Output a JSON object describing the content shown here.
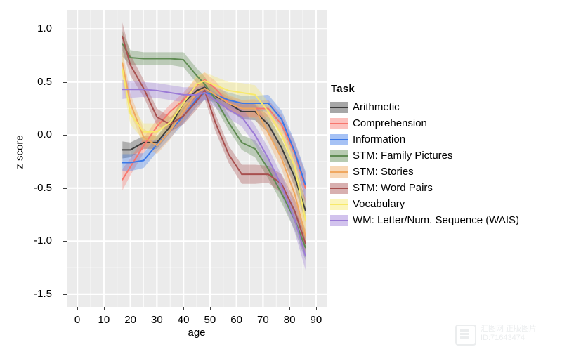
{
  "chart_data": {
    "type": "line",
    "title": "",
    "xlabel": "age",
    "ylabel": "z score",
    "xlim": [
      -4,
      94
    ],
    "ylim": [
      -1.62,
      1.18
    ],
    "xticks": [
      0,
      10,
      20,
      30,
      40,
      50,
      60,
      70,
      80,
      90
    ],
    "xtick_labels": [
      "0",
      "10",
      "20",
      "30",
      "40",
      "50",
      "60",
      "70",
      "80",
      "90"
    ],
    "yticks": [
      1.0,
      0.5,
      0.0,
      -0.5,
      -1.0,
      -1.5
    ],
    "ytick_labels": [
      "1.0",
      "0.5",
      "0.0",
      "-0.5",
      "-1.0",
      "-1.5"
    ],
    "grid": true,
    "grid_minor": true,
    "panel_bg": "#ebebeb",
    "grid_color": "#ffffff",
    "legend_title": "Task",
    "legend_position": "right",
    "band_type": "confidence ribbon",
    "series": [
      {
        "name": "Arithmetic",
        "color": "#3c3c3c",
        "x": [
          17,
          20,
          25,
          30,
          35,
          40,
          45,
          48,
          52,
          57,
          62,
          67,
          72,
          77,
          82,
          86
        ],
        "y": [
          -0.14,
          -0.14,
          -0.07,
          -0.07,
          0.08,
          0.3,
          0.42,
          0.45,
          0.37,
          0.3,
          0.22,
          0.22,
          0.1,
          -0.12,
          -0.4,
          -0.71
        ],
        "lower": [
          -0.22,
          -0.21,
          -0.13,
          -0.13,
          0.02,
          0.24,
          0.36,
          0.39,
          0.31,
          0.24,
          0.15,
          0.14,
          0.02,
          -0.2,
          -0.49,
          -0.82
        ],
        "upper": [
          -0.06,
          -0.07,
          -0.01,
          -0.01,
          0.14,
          0.36,
          0.48,
          0.51,
          0.43,
          0.36,
          0.29,
          0.3,
          0.18,
          -0.04,
          -0.31,
          -0.6
        ]
      },
      {
        "name": "Comprehension",
        "color": "#f8766d",
        "x": [
          17,
          20,
          25,
          30,
          35,
          40,
          45,
          48,
          52,
          57,
          62,
          67,
          72,
          77,
          82,
          86
        ],
        "y": [
          -0.42,
          -0.3,
          -0.1,
          0.08,
          0.22,
          0.33,
          0.47,
          0.52,
          0.44,
          0.3,
          0.25,
          0.25,
          0.25,
          0.1,
          -0.18,
          -0.5
        ],
        "lower": [
          -0.52,
          -0.38,
          -0.17,
          0.01,
          0.15,
          0.26,
          0.4,
          0.45,
          0.37,
          0.23,
          0.17,
          0.17,
          0.17,
          0.01,
          -0.29,
          -0.64
        ],
        "upper": [
          -0.32,
          -0.22,
          -0.03,
          0.15,
          0.29,
          0.4,
          0.54,
          0.59,
          0.51,
          0.37,
          0.33,
          0.33,
          0.33,
          0.19,
          -0.07,
          -0.36
        ]
      },
      {
        "name": "Information",
        "color": "#3a78e8",
        "x": [
          17,
          20,
          25,
          30,
          35,
          40,
          45,
          48,
          52,
          57,
          62,
          67,
          72,
          77,
          82,
          86
        ],
        "y": [
          -0.26,
          -0.26,
          -0.24,
          -0.09,
          0.04,
          0.18,
          0.34,
          0.4,
          0.38,
          0.33,
          0.3,
          0.3,
          0.3,
          0.15,
          -0.16,
          -0.47
        ],
        "lower": [
          -0.34,
          -0.34,
          -0.31,
          -0.16,
          -0.03,
          0.11,
          0.27,
          0.33,
          0.31,
          0.26,
          0.23,
          0.23,
          0.22,
          0.07,
          -0.26,
          -0.6
        ],
        "upper": [
          -0.18,
          -0.18,
          -0.17,
          -0.02,
          0.11,
          0.25,
          0.41,
          0.47,
          0.45,
          0.4,
          0.37,
          0.37,
          0.38,
          0.23,
          -0.06,
          -0.34
        ]
      },
      {
        "name": "STM: Family Pictures",
        "color": "#5f8b52",
        "x": [
          17,
          20,
          25,
          30,
          35,
          40,
          45,
          48,
          52,
          57,
          62,
          67,
          72,
          77,
          82,
          86
        ],
        "y": [
          0.86,
          0.73,
          0.72,
          0.72,
          0.72,
          0.71,
          0.56,
          0.48,
          0.34,
          0.12,
          -0.07,
          -0.13,
          -0.32,
          -0.55,
          -0.8,
          -1.06
        ],
        "lower": [
          0.74,
          0.66,
          0.66,
          0.66,
          0.66,
          0.64,
          0.49,
          0.41,
          0.27,
          0.05,
          -0.14,
          -0.21,
          -0.41,
          -0.64,
          -0.9,
          -1.18
        ],
        "upper": [
          0.98,
          0.8,
          0.78,
          0.78,
          0.78,
          0.78,
          0.63,
          0.55,
          0.41,
          0.19,
          0.0,
          -0.05,
          -0.23,
          -0.46,
          -0.7,
          -0.94
        ]
      },
      {
        "name": "STM: Stories",
        "color": "#f0a860",
        "x": [
          17,
          20,
          25,
          30,
          35,
          40,
          45,
          48,
          52,
          57,
          62,
          67,
          72,
          77,
          82,
          86
        ],
        "y": [
          0.68,
          0.3,
          -0.02,
          -0.1,
          0.04,
          0.22,
          0.4,
          0.44,
          0.38,
          0.3,
          0.25,
          0.25,
          0.02,
          -0.22,
          -0.56,
          -0.95
        ],
        "lower": [
          0.56,
          0.21,
          -0.1,
          -0.18,
          -0.04,
          0.14,
          0.33,
          0.37,
          0.31,
          0.22,
          0.17,
          0.16,
          -0.07,
          -0.32,
          -0.68,
          -1.08
        ],
        "upper": [
          0.8,
          0.39,
          0.06,
          -0.02,
          0.12,
          0.3,
          0.47,
          0.51,
          0.45,
          0.38,
          0.33,
          0.34,
          0.11,
          -0.12,
          -0.44,
          -0.82
        ]
      },
      {
        "name": "STM: Word Pairs",
        "color": "#a8504f",
        "x": [
          17,
          20,
          25,
          30,
          35,
          40,
          45,
          48,
          52,
          57,
          62,
          67,
          72,
          77,
          82,
          86
        ],
        "y": [
          0.93,
          0.66,
          0.44,
          0.17,
          0.1,
          0.18,
          0.32,
          0.42,
          0.12,
          -0.18,
          -0.37,
          -0.37,
          -0.37,
          -0.46,
          -0.72,
          -1.02
        ],
        "lower": [
          0.8,
          0.56,
          0.36,
          0.09,
          0.03,
          0.1,
          0.24,
          0.34,
          0.04,
          -0.26,
          -0.46,
          -0.46,
          -0.45,
          -0.55,
          -0.83,
          -1.15
        ],
        "upper": [
          1.06,
          0.76,
          0.52,
          0.25,
          0.17,
          0.26,
          0.4,
          0.5,
          0.2,
          -0.1,
          -0.28,
          -0.28,
          -0.29,
          -0.37,
          -0.61,
          -0.89
        ]
      },
      {
        "name": "Vocabulary",
        "color": "#f7e96a",
        "x": [
          17,
          20,
          25,
          30,
          35,
          40,
          45,
          48,
          52,
          57,
          62,
          67,
          72,
          77,
          82,
          86
        ],
        "y": [
          0.62,
          0.2,
          0.03,
          0.03,
          0.12,
          0.3,
          0.48,
          0.51,
          0.47,
          0.42,
          0.4,
          0.38,
          0.22,
          0.0,
          -0.3,
          -0.8
        ],
        "lower": [
          0.5,
          0.1,
          -0.05,
          -0.05,
          0.04,
          0.22,
          0.4,
          0.43,
          0.39,
          0.34,
          0.31,
          0.29,
          0.13,
          -0.1,
          -0.42,
          -0.94
        ],
        "upper": [
          0.74,
          0.3,
          0.11,
          0.11,
          0.2,
          0.38,
          0.56,
          0.59,
          0.55,
          0.5,
          0.49,
          0.47,
          0.31,
          0.1,
          -0.18,
          -0.66
        ]
      },
      {
        "name": "WM: Letter/Num. Sequence (WAIS)",
        "color": "#9b7ad6",
        "x": [
          17,
          20,
          25,
          30,
          35,
          40,
          45,
          48,
          52,
          57,
          62,
          67,
          72,
          77,
          82,
          86
        ],
        "y": [
          0.43,
          0.43,
          0.43,
          0.42,
          0.4,
          0.38,
          0.38,
          0.4,
          0.33,
          0.24,
          0.17,
          0.0,
          -0.22,
          -0.48,
          -0.8,
          -1.14
        ],
        "lower": [
          0.34,
          0.35,
          0.36,
          0.35,
          0.33,
          0.31,
          0.31,
          0.33,
          0.26,
          0.16,
          0.08,
          -0.09,
          -0.32,
          -0.58,
          -0.92,
          -1.27
        ],
        "upper": [
          0.52,
          0.51,
          0.5,
          0.49,
          0.47,
          0.45,
          0.45,
          0.47,
          0.4,
          0.32,
          0.26,
          0.09,
          -0.12,
          -0.38,
          -0.68,
          -1.01
        ]
      }
    ]
  },
  "axis": {
    "x_title": "age",
    "y_title": "z score"
  },
  "legend": {
    "title": "Task",
    "items": [
      {
        "label": "Arithmetic",
        "color": "#3c3c3c"
      },
      {
        "label": "Comprehension",
        "color": "#f8766d"
      },
      {
        "label": "Information",
        "color": "#3a78e8"
      },
      {
        "label": "STM: Family Pictures",
        "color": "#5f8b52"
      },
      {
        "label": "STM: Stories",
        "color": "#f0a860"
      },
      {
        "label": "STM: Word Pairs",
        "color": "#a8504f"
      },
      {
        "label": "Vocabulary",
        "color": "#f7e96a"
      },
      {
        "label": "WM: Letter/Num. Sequence (WAIS)",
        "color": "#9b7ad6"
      }
    ]
  },
  "watermark": {
    "line1": "汇图网 正版图片",
    "line2": "ID:71643474"
  }
}
